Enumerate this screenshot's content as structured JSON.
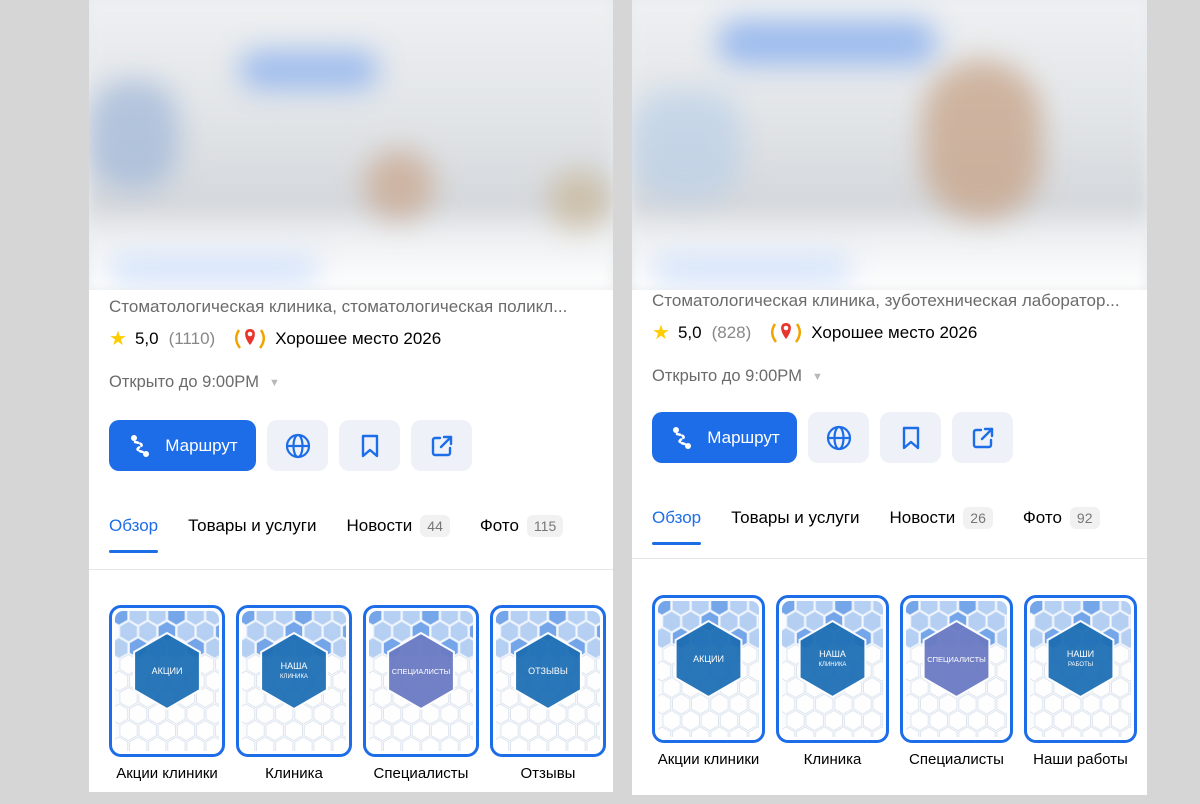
{
  "colors": {
    "accent": "#1d6de8",
    "star": "#ffcc00",
    "hex_blue": "#1e6fb5",
    "hex_violet": "#6b7bc4",
    "panel_bg": "#ffffff",
    "page_bg": "#d6d6d6"
  },
  "panels": [
    {
      "category": "Стоматологическая клиника, стоматологическая поликл...",
      "rating": {
        "icon": "star-icon",
        "score": "5,0",
        "count": "(1110)"
      },
      "award": {
        "icon": "laurel-pin-icon",
        "text": "Хорошее место 2026"
      },
      "hours": {
        "text": "Открыто до 9:00PM",
        "icon": "caret-down-icon"
      },
      "actions": {
        "route_label": "Маршрут",
        "route_icon": "route-icon",
        "icons": [
          "globe-icon",
          "bookmark-icon",
          "share-icon"
        ]
      },
      "tabs": [
        {
          "label": "Обзор",
          "badge": ""
        },
        {
          "label": "Товары и услуги",
          "badge": ""
        },
        {
          "label": "Новости",
          "badge": "44"
        },
        {
          "label": "Фото",
          "badge": "115"
        }
      ],
      "stories": [
        {
          "title": "АКЦИИ",
          "subtitle": "",
          "label": "Акции клиники",
          "hex": "blue"
        },
        {
          "title": "НАША",
          "subtitle": "КЛИНИКА",
          "label": "Клиника",
          "hex": "blue"
        },
        {
          "title": "СПЕЦИАЛИСТЫ",
          "subtitle": "",
          "label": "Специалисты",
          "hex": "violet"
        },
        {
          "title": "ОТЗЫВЫ",
          "subtitle": "",
          "label": "Отзывы",
          "hex": "blue"
        }
      ]
    },
    {
      "category": "Стоматологическая клиника, зуботехническая лаборатор...",
      "rating": {
        "icon": "star-icon",
        "score": "5,0",
        "count": "(828)"
      },
      "award": {
        "icon": "laurel-pin-icon",
        "text": "Хорошее место 2026"
      },
      "hours": {
        "text": "Открыто до 9:00PM",
        "icon": "caret-down-icon"
      },
      "actions": {
        "route_label": "Маршрут",
        "route_icon": "route-icon",
        "icons": [
          "globe-icon",
          "bookmark-icon",
          "share-icon"
        ]
      },
      "tabs": [
        {
          "label": "Обзор",
          "badge": ""
        },
        {
          "label": "Товары и услуги",
          "badge": ""
        },
        {
          "label": "Новости",
          "badge": "26"
        },
        {
          "label": "Фото",
          "badge": "92"
        }
      ],
      "stories": [
        {
          "title": "АКЦИИ",
          "subtitle": "",
          "label": "Акции клиники",
          "hex": "blue"
        },
        {
          "title": "НАША",
          "subtitle": "КЛИНИКА",
          "label": "Клиника",
          "hex": "blue"
        },
        {
          "title": "СПЕЦИАЛИСТЫ",
          "subtitle": "",
          "label": "Специалисты",
          "hex": "violet"
        },
        {
          "title": "НАШИ",
          "subtitle": "РАБОТЫ",
          "label": "Наши работы",
          "hex": "blue"
        }
      ]
    }
  ]
}
